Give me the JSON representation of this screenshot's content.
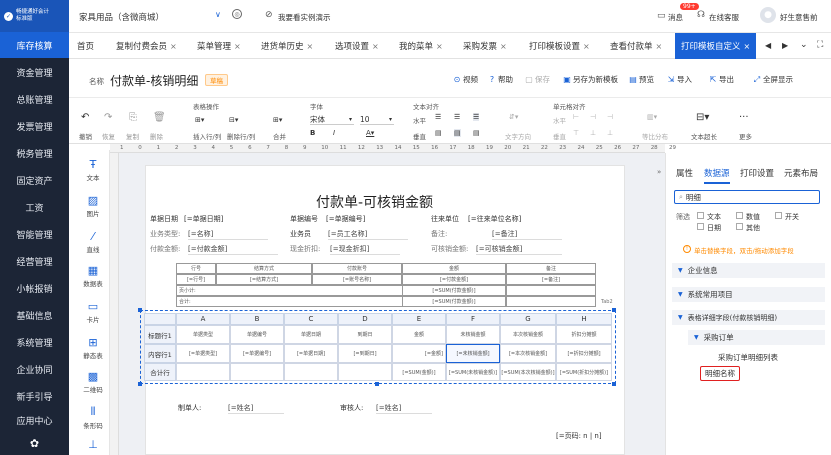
{
  "logo": {
    "line1": "畅捷通好会计",
    "line2": "标准版"
  },
  "sidebar": {
    "items": [
      {
        "label": "库存核算",
        "active": true
      },
      {
        "label": "资金管理"
      },
      {
        "label": "总账管理"
      },
      {
        "label": "发票管理"
      },
      {
        "label": "税务管理"
      },
      {
        "label": "固定资产"
      },
      {
        "label": "工资"
      },
      {
        "label": "智能管理"
      },
      {
        "label": "经营管理"
      },
      {
        "label": "小帐报销"
      },
      {
        "label": "基础信息"
      },
      {
        "label": "系统管理"
      },
      {
        "label": "企业协同"
      },
      {
        "label": "新手引导"
      },
      {
        "label": "应用中心"
      }
    ]
  },
  "topbar": {
    "company": "家具用品（含微商城）",
    "demo": "我要看实例演示",
    "messages": "消息",
    "msg_badge": "99+",
    "service": "在线客服",
    "user": "好生意售前"
  },
  "tabs": [
    {
      "label": "首页"
    },
    {
      "label": "复制付费会员"
    },
    {
      "label": "菜单管理"
    },
    {
      "label": "进货单历史"
    },
    {
      "label": "选项设置"
    },
    {
      "label": "我的菜单"
    },
    {
      "label": "采购发票"
    },
    {
      "label": "打印模板设置"
    },
    {
      "label": "查看付款单"
    },
    {
      "label": "打印模板自定义",
      "active": true
    }
  ],
  "title_row": {
    "name_label": "名称",
    "name": "付款单-核销明细",
    "badge": "草稿",
    "video": "视频",
    "help": "帮助",
    "save": "保存",
    "save_as": "另存为新模板",
    "preview": "预览",
    "import": "导入",
    "export": "导出",
    "fullscreen": "全屏显示"
  },
  "ribbon": {
    "undo": "撤销",
    "redo": "恢复",
    "copy": "复制",
    "delete": "删除",
    "table_ops": "表格操作",
    "insert": "插入行/列",
    "delete_rc": "删除行/列",
    "merge": "合并",
    "font": "字体",
    "font_name": "宋体",
    "font_size": "10",
    "text_align": "文本对齐",
    "h_align": "水平",
    "v_align": "垂直",
    "text_dir": "文字方向",
    "cell_align": "单元格对齐",
    "cell_h": "水平",
    "cell_v": "垂直",
    "equal_dist": "等比分布",
    "text_grow": "文本超长",
    "more": "更多"
  },
  "tools": [
    {
      "label": "文本",
      "icon": "text-icon"
    },
    {
      "label": "图片",
      "icon": "image-icon"
    },
    {
      "label": "直线",
      "icon": "line-icon"
    },
    {
      "label": "数据表",
      "icon": "table-icon"
    },
    {
      "label": "卡片",
      "icon": "card-icon"
    },
    {
      "label": "静态表",
      "icon": "static-table-icon"
    },
    {
      "label": "二维码",
      "icon": "qrcode-icon"
    },
    {
      "label": "条形码",
      "icon": "barcode-icon"
    }
  ],
  "ruler_numbers": [
    "1",
    "0",
    "1",
    "2",
    "3",
    "4",
    "5",
    "6",
    "7",
    "8",
    "9",
    "10",
    "11",
    "12",
    "13",
    "14",
    "15",
    "16",
    "17",
    "18",
    "19",
    "20",
    "21",
    "22",
    "23",
    "24",
    "25",
    "26",
    "27",
    "28",
    "29"
  ],
  "paper": {
    "title": "付款单-可核销金额",
    "fields": [
      {
        "label": "单据日期",
        "value": "[=单据日期]"
      },
      {
        "label": "单据编号",
        "value": "[=单据编号]"
      },
      {
        "label": "往来单位",
        "value": "[=往来单位名称]"
      },
      {
        "label": "业务类型:",
        "value": "[=名称]"
      },
      {
        "label": "业务员",
        "value": "[=员工名称]"
      },
      {
        "label": "备注:",
        "value": "[=备注]"
      },
      {
        "label": "付款金额:",
        "value": "[=付款金额]"
      },
      {
        "label": "现金折扣:",
        "value": "[=现金折扣]"
      },
      {
        "label": "可核销金额:",
        "value": "[=可核销金额]"
      }
    ],
    "inner_table": {
      "headers": [
        "行号",
        "结算方式",
        "付款账号",
        "金额",
        "备注"
      ],
      "row": [
        "[=行号]",
        "[=结算方式]",
        "[=账号名称]",
        "[=付款金额]",
        "[=备注]"
      ],
      "sum_label": "页小计:",
      "sum_value": "[=SUM(付款金额)]",
      "total_label": "合计:",
      "total_value": "[=SUM(付款金额)]",
      "tab2": "Tab2"
    },
    "grid": {
      "cols": [
        "A",
        "B",
        "C",
        "D",
        "E",
        "F",
        "G",
        "H"
      ],
      "rows": [
        {
          "name": "标题行1",
          "cells": [
            "单据类型",
            "单据编号",
            "单据日期",
            "到期日",
            "金额",
            "未核销金额",
            "本次核销金额",
            "折扣分摊额"
          ]
        },
        {
          "name": "内容行1",
          "cells": [
            "[=单据类型]",
            "[=单据编号]",
            "[=单据日期]",
            "[=到期日]",
            "[=金额]",
            "[=未核销金额]",
            "[=本次核销金额]",
            "[=折扣分摊额]"
          ]
        },
        {
          "name": "合计行",
          "cells": [
            "",
            "",
            "",
            "",
            "[=SUM(金额)]",
            "[=SUM(未核销金额)]",
            "[=SUM(本次核销金额)]",
            "[=SUM(折扣分摊额)]"
          ]
        }
      ]
    },
    "maker_label": "制单人:",
    "maker_value": "[=姓名]",
    "auditor_label": "审核人:",
    "auditor_value": "[=姓名]",
    "page_no": "[=页码: n | n]"
  },
  "right_panel": {
    "tabs": [
      "属性",
      "数据源",
      "打印设置",
      "元素布局"
    ],
    "active_tab": "数据源",
    "search_value": "明细",
    "filter_label": "筛选",
    "filters": [
      "文本",
      "数值",
      "开关",
      "日期",
      "其他"
    ],
    "hint": "单击替换字段，双击/拖动添加字段",
    "tree": [
      {
        "label": "企业信息"
      },
      {
        "label": "系统常用项目"
      },
      {
        "label": "表格详细字段(付款核销明细)"
      },
      {
        "label": "采购订单"
      }
    ],
    "leaf1": "采购订单明细列表",
    "leaf2": "明细名称"
  },
  "colors": {
    "accent": "#1a62d6",
    "sidebar_bg": "#1c2536",
    "badge": "#ff8a00",
    "highlight": "#e02020"
  }
}
